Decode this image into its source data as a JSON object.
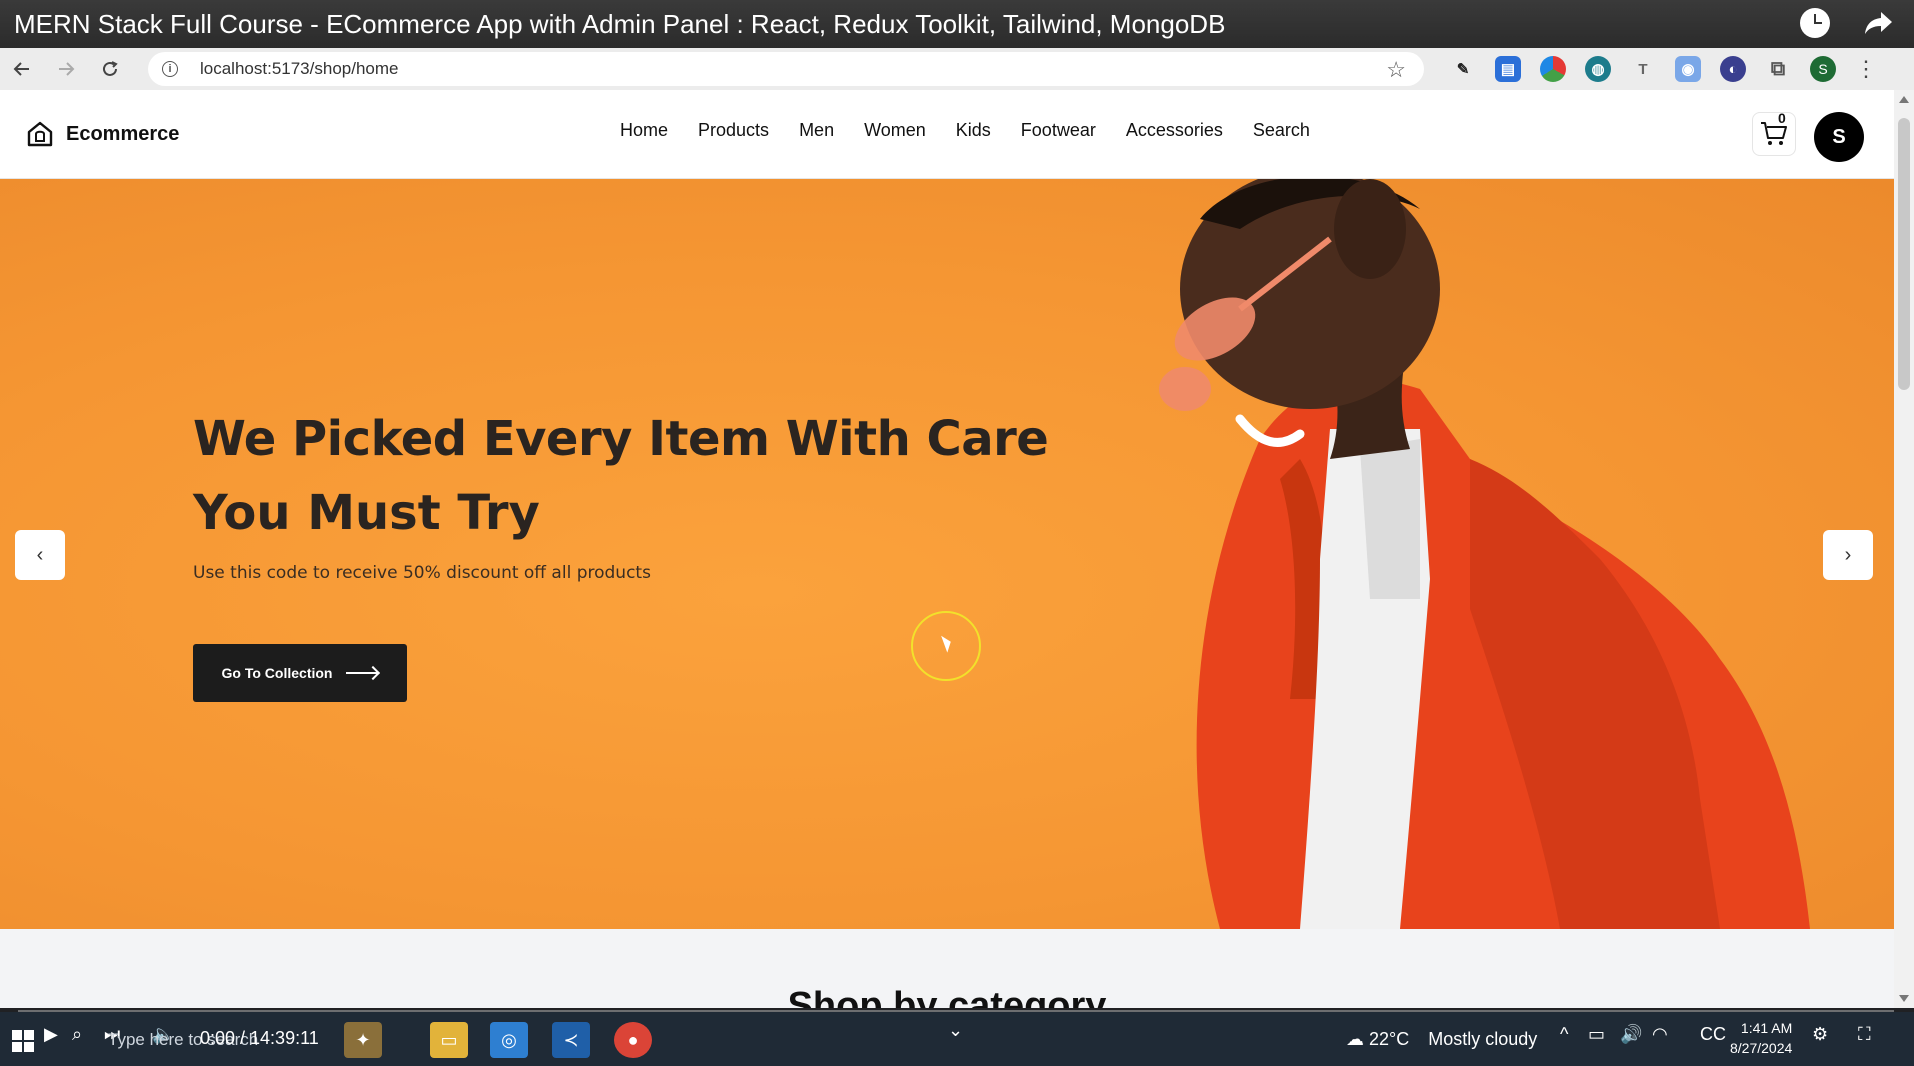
{
  "video": {
    "title": "MERN Stack Full Course - ECommerce App with Admin Panel : React, Redux Toolkit, Tailwind, MongoDB",
    "time": "0:00 / 14:39:11"
  },
  "browser": {
    "url": "localhost:5173/shop/home",
    "profile_initial": "S"
  },
  "site": {
    "logo_text": "Ecommerce",
    "nav": [
      "Home",
      "Products",
      "Men",
      "Women",
      "Kids",
      "Footwear",
      "Accessories",
      "Search"
    ],
    "cart_count": "0",
    "avatar_initial": "S"
  },
  "hero": {
    "heading_line1": "We Picked Every Item With Care",
    "heading_line2": "You Must Try",
    "subtitle": "Use this code to receive 50% discount off all products",
    "cta_label": "Go To Collection",
    "prev_label": "‹",
    "next_label": "›"
  },
  "category": {
    "title": "Shop by category"
  },
  "taskbar": {
    "search_placeholder": "Type here to search",
    "weather_temp": "22°C",
    "weather_text": "Mostly cloudy",
    "clock_time": "1:41 AM",
    "clock_date": "8/27/2024"
  },
  "colors": {
    "hero_bg": "#f59633",
    "jacket": "#e8431c",
    "cta_bg": "#1c1c1c"
  }
}
